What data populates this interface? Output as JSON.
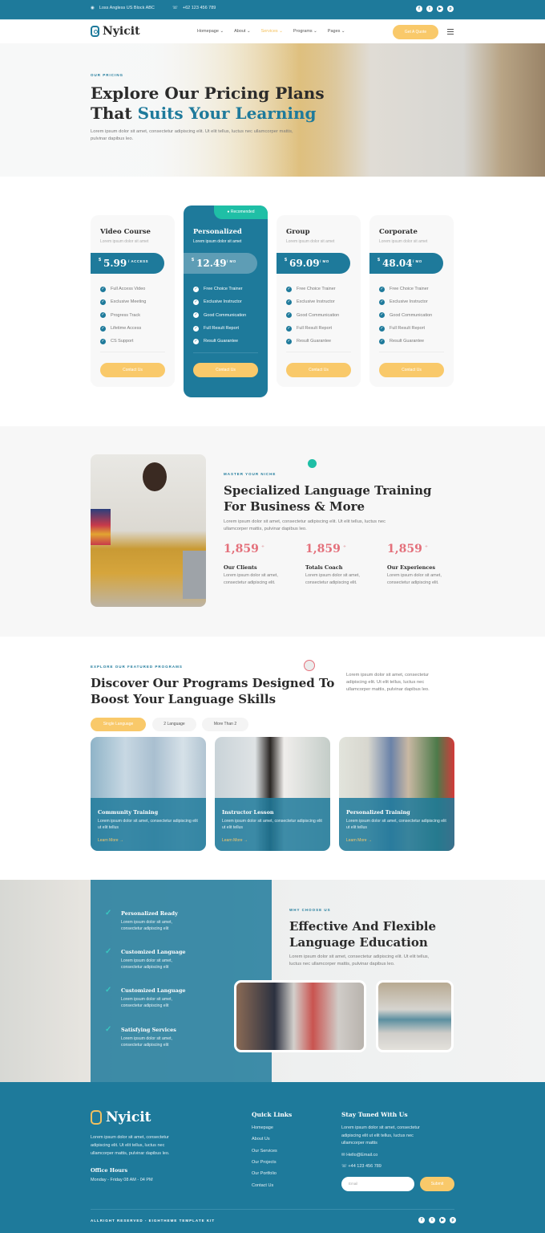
{
  "topbar": {
    "address": "Loss Angless US Block ABC",
    "phone": "+62 123 456 789",
    "social": [
      "facebook-icon",
      "twitter-icon",
      "youtube-icon",
      "pinterest-icon"
    ]
  },
  "nav": {
    "brand": "Nyicit",
    "items": [
      "Homepage",
      "About",
      "Services",
      "Programs",
      "Pages"
    ],
    "active": "Services",
    "cta": "Get A Quote"
  },
  "hero": {
    "kicker": "OUR PRICING",
    "title_line1": "Explore Our Pricing Plans",
    "title_line2_plain": "That ",
    "title_line2_accent": "Suits Your Learning",
    "desc": "Lorem ipsum dolor sit amet, consectetur adipiscing elit. Ut elit tellus, luctus nec ullamcorper mattis, pulvinar dapibus leo."
  },
  "pricing": {
    "plans": [
      {
        "name": "Video Course",
        "sub": "Lorem ipsum dolor sit amet",
        "currency": "$",
        "amount": "5.99",
        "period": "/ ACCESS",
        "features": [
          "Full Access Video",
          "Exclusive Meeting",
          "Progress Track",
          "Lifetime Access",
          "CS Support"
        ],
        "cta": "Contact Us"
      },
      {
        "name": "Personalized",
        "sub": "Lorem ipsum dolor sit amet",
        "currency": "$",
        "amount": "12.49",
        "period": "/ MO",
        "badge": "Recomended",
        "features": [
          "Free Choice Trainer",
          "Exclusive Instructor",
          "Good Communication",
          "Full Result Report",
          "Result Guarantee"
        ],
        "cta": "Contact Us"
      },
      {
        "name": "Group",
        "sub": "Lorem ipsum dolor sit amet",
        "currency": "$",
        "amount": "69.09",
        "period": "/ MO",
        "features": [
          "Free Choice Trainer",
          "Exclusive Instructor",
          "Good Communication",
          "Full Result Report",
          "Result Guarantee"
        ],
        "cta": "Contact Us"
      },
      {
        "name": "Corporate",
        "sub": "Lorem ipsum dolor sit amet",
        "currency": "$",
        "amount": "48.04",
        "period": "/ MO",
        "features": [
          "Free Choice Trainer",
          "Exclusive Instructor",
          "Good Communication",
          "Full Result Report",
          "Result Guarantee"
        ],
        "cta": "Contact Us"
      }
    ]
  },
  "specialized": {
    "kicker": "MASTER YOUR NICHE",
    "title_line1": "Specialized Language Training",
    "title_line2": "For Business & More",
    "desc_line1": "Lorem ipsum dolor sit amet, consectetur adipiscing elit. Ut elit tellus, luctus nec",
    "desc_line2": "ullamcorper mattis, pulvinar dapibus leo.",
    "stats": [
      {
        "value": "1,859",
        "suffix": "+",
        "label": "Our Clients",
        "desc1": "Lorem ipsum dolor sit amet,",
        "desc2": "consectetur adipiscing elit."
      },
      {
        "value": "1,859",
        "suffix": "+",
        "label": "Totals Coach",
        "desc1": "Lorem ipsum dolor sit amet,",
        "desc2": "consectetur adipiscing elit."
      },
      {
        "value": "1,859",
        "suffix": "+",
        "label": "Our Experiences",
        "desc1": "Lorem ipsum dolor sit amet,",
        "desc2": "consectetur adipiscing elit."
      }
    ]
  },
  "programs": {
    "kicker": "EXPLORE OUR FEATURED PROGRAMS",
    "title_line1": "Discover Our Programs Designed To",
    "title_line2": "Boost Your Language Skills",
    "desc_line1": "Lorem ipsum dolor sit amet, consectetur",
    "desc_line2": "adipiscing elit. Ut elit tellus, luctus nec",
    "desc_line3": "ullamcorper mattis, pulvinar dapibus leo.",
    "tabs": [
      "Single Language",
      "2 Language",
      "More Than 2"
    ],
    "active_tab": "Single Language",
    "cards": [
      {
        "title": "Community Training",
        "desc": "Lorem ipsum dolor sit amet, consectetur adipiscing elit ut elit tellus",
        "link": "Learn More"
      },
      {
        "title": "Instructor Lesson",
        "desc": "Lorem ipsum dolor sit amet, consectetur adipiscing elit ut elit tellus",
        "link": "Learn More"
      },
      {
        "title": "Personalized Training",
        "desc": "Lorem ipsum dolor sit amet, consectetur adipiscing elit ut elit tellus",
        "link": "Learn More"
      }
    ]
  },
  "why": {
    "kicker": "WHY CHOOSE US",
    "title_line1": "Effective And Flexible",
    "title_line2": "Language Education",
    "desc_line1": "Lorem ipsum dolor sit amet, consectetur adipiscing elit. Ut elit tellus,",
    "desc_line2": "luctus nec ullamcorper mattis, pulvinar dapibus leo.",
    "points": [
      {
        "title": "Personalized Ready",
        "d1": "Lorem ipsum dolor sit amet,",
        "d2": "consectetur adipiscing elit"
      },
      {
        "title": "Customized Language",
        "d1": "Lorem ipsum dolor sit amet,",
        "d2": "consectetur adipiscing elit"
      },
      {
        "title": "Customized Language",
        "d1": "Lorem ipsum dolor sit amet,",
        "d2": "consectetur adipiscing elit"
      },
      {
        "title": "Satisfying Services",
        "d1": "Lorem ipsum dolor sit amet,",
        "d2": "consectetur adipiscing elit"
      }
    ]
  },
  "footer": {
    "brand": "Nyicit",
    "about_l1": "Lorem ipsum dolor sit amet, consectetur",
    "about_l2": "adipiscing elit. Ut elit tellus, luctus nec",
    "about_l3": "ullamcorper mattis, pulvinar dapibus leo.",
    "hours_title": "Office Hours",
    "hours": "Monday - Friday 08 AM - 04 PM",
    "links_title": "Quick Links",
    "links": [
      "Homepage",
      "About Us",
      "Our Services",
      "Our Projects",
      "Our Portfolio",
      "Contact Us"
    ],
    "news_title": "Stay Tuned With Us",
    "news_l1": "Lorem ipsum dolor sit amet, consectetur",
    "news_l2": "adipiscing elit ut elit tellus, luctus nec",
    "news_l3": "ullamcorper mattis",
    "email": "Hello@Email.co",
    "phone": "+44 123 456 789",
    "email_placeholder": "Email",
    "submit": "Submit",
    "copyright": "ALLRIGHT RESERVED - EIGHTHEME TEMPLATE KIT"
  }
}
